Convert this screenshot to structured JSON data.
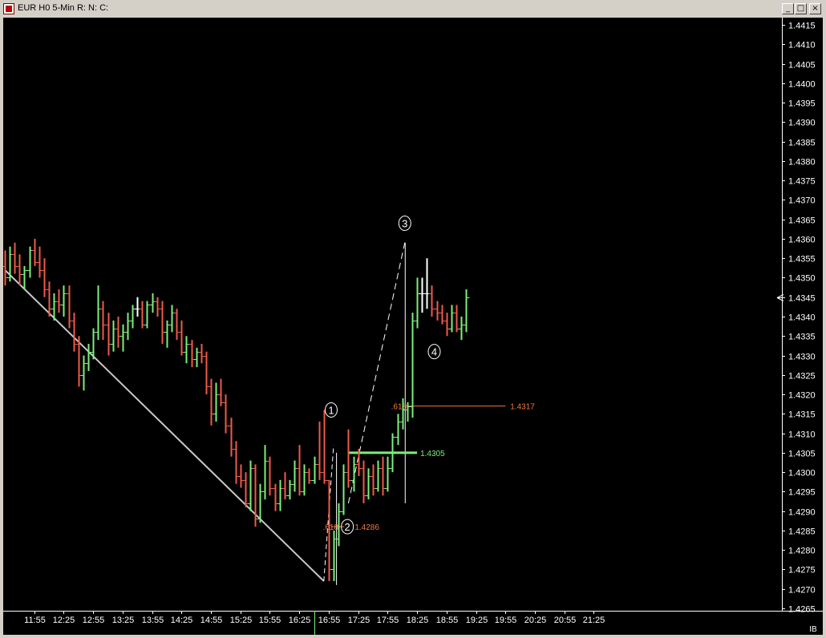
{
  "window": {
    "title": "EUR H0 5-Min R: N: C:",
    "minimize_label": "_",
    "restore_label": "□",
    "close_label": "×"
  },
  "chart_data": {
    "type": "ohlc",
    "instrument": "EUR H0",
    "interval": "5-Min",
    "ylim": [
      1.4263,
      1.4418
    ],
    "y_ticks": [
      "1.4265",
      "1.4270",
      "1.4275",
      "1.4280",
      "1.4285",
      "1.4290",
      "1.4295",
      "1.4300",
      "1.4305",
      "1.4310",
      "1.4315",
      "1.4320",
      "1.4325",
      "1.4330",
      "1.4335",
      "1.4340",
      "1.4345",
      "1.4350",
      "1.4355",
      "1.4360",
      "1.4365",
      "1.4370",
      "1.4375",
      "1.4380",
      "1.4385",
      "1.4390",
      "1.4395",
      "1.4400",
      "1.4405",
      "1.4410",
      "1.4415"
    ],
    "x_ticks": [
      "11:55",
      "12:25",
      "12:55",
      "13:25",
      "13:55",
      "14:25",
      "14:55",
      "15:25",
      "15:55",
      "16:25",
      "16:55",
      "17:25",
      "17:55",
      "18:25",
      "18:55",
      "19:25",
      "19:55",
      "20:25",
      "20:55",
      "21:25"
    ],
    "x_tick_bar_index": [
      6,
      12,
      18,
      24,
      30,
      36,
      42,
      48,
      54,
      60,
      66,
      72,
      78,
      84,
      90,
      96,
      102,
      108,
      114,
      120
    ],
    "bars": [
      [
        1.4353,
        1.4357,
        1.4348,
        1.435
      ],
      [
        1.435,
        1.4358,
        1.4349,
        1.4356
      ],
      [
        1.4356,
        1.4359,
        1.4351,
        1.4353
      ],
      [
        1.4353,
        1.4356,
        1.4348,
        1.4351
      ],
      [
        1.4351,
        1.4353,
        1.4347,
        1.4352
      ],
      [
        1.4352,
        1.4358,
        1.435,
        1.4357
      ],
      [
        1.4357,
        1.436,
        1.4353,
        1.4354
      ],
      [
        1.4354,
        1.4358,
        1.435,
        1.4352
      ],
      [
        1.4352,
        1.4355,
        1.4345,
        1.4347
      ],
      [
        1.4347,
        1.4349,
        1.434,
        1.4342
      ],
      [
        1.4342,
        1.4346,
        1.4339,
        1.4344
      ],
      [
        1.4344,
        1.4347,
        1.4341,
        1.4343
      ],
      [
        1.4343,
        1.4348,
        1.434,
        1.4346
      ],
      [
        1.4346,
        1.4348,
        1.4337,
        1.4339
      ],
      [
        1.4339,
        1.4341,
        1.4331,
        1.4333
      ],
      [
        1.4333,
        1.4335,
        1.4322,
        1.4325
      ],
      [
        1.4325,
        1.433,
        1.4321,
        1.4328
      ],
      [
        1.4328,
        1.4333,
        1.4326,
        1.4331
      ],
      [
        1.4331,
        1.4337,
        1.4329,
        1.4336
      ],
      [
        1.4336,
        1.4348,
        1.4334,
        1.4342
      ],
      [
        1.4342,
        1.4344,
        1.4334,
        1.4338
      ],
      [
        1.4338,
        1.4341,
        1.433,
        1.4333
      ],
      [
        1.4333,
        1.4339,
        1.4331,
        1.4337
      ],
      [
        1.4337,
        1.434,
        1.4332,
        1.4335
      ],
      [
        1.4335,
        1.4338,
        1.4331,
        1.4336
      ],
      [
        1.4336,
        1.4341,
        1.4334,
        1.4339
      ],
      [
        1.4339,
        1.4343,
        1.4337,
        1.4342
      ],
      [
        1.4342,
        1.4345,
        1.434,
        1.4342
      ],
      [
        1.4342,
        1.4344,
        1.4337,
        1.4338
      ],
      [
        1.4338,
        1.4344,
        1.4337,
        1.4343
      ],
      [
        1.4343,
        1.4346,
        1.4341,
        1.4344
      ],
      [
        1.4344,
        1.4345,
        1.434,
        1.4342
      ],
      [
        1.4342,
        1.4344,
        1.4333,
        1.4336
      ],
      [
        1.4336,
        1.4339,
        1.4332,
        1.4338
      ],
      [
        1.4338,
        1.4343,
        1.4336,
        1.4341
      ],
      [
        1.4341,
        1.4342,
        1.4334,
        1.4336
      ],
      [
        1.4336,
        1.4339,
        1.433,
        1.4331
      ],
      [
        1.4331,
        1.4335,
        1.4328,
        1.4333
      ],
      [
        1.4333,
        1.4334,
        1.4327,
        1.4329
      ],
      [
        1.4329,
        1.4332,
        1.4327,
        1.4331
      ],
      [
        1.4331,
        1.4333,
        1.4328,
        1.433
      ],
      [
        1.433,
        1.4331,
        1.432,
        1.4322
      ],
      [
        1.4322,
        1.4324,
        1.4312,
        1.4315
      ],
      [
        1.4315,
        1.4323,
        1.4313,
        1.432
      ],
      [
        1.432,
        1.4324,
        1.4317,
        1.4318
      ],
      [
        1.4318,
        1.432,
        1.431,
        1.4312
      ],
      [
        1.4312,
        1.4314,
        1.4304,
        1.4306
      ],
      [
        1.4306,
        1.4308,
        1.4297,
        1.4299
      ],
      [
        1.4299,
        1.4302,
        1.4296,
        1.4298
      ],
      [
        1.4298,
        1.43,
        1.4291,
        1.4292
      ],
      [
        1.4292,
        1.4303,
        1.429,
        1.4301
      ],
      [
        1.4301,
        1.4302,
        1.4286,
        1.4288
      ],
      [
        1.4288,
        1.4297,
        1.4287,
        1.4295
      ],
      [
        1.4295,
        1.4307,
        1.4293,
        1.4303
      ],
      [
        1.4303,
        1.4304,
        1.4294,
        1.4296
      ],
      [
        1.4296,
        1.4297,
        1.429,
        1.4292
      ],
      [
        1.4292,
        1.4298,
        1.429,
        1.4296
      ],
      [
        1.4296,
        1.43,
        1.4293,
        1.4294
      ],
      [
        1.4294,
        1.4298,
        1.4293,
        1.4297
      ],
      [
        1.4297,
        1.4303,
        1.4295,
        1.4301
      ],
      [
        1.4301,
        1.4307,
        1.4294,
        1.4295
      ],
      [
        1.4295,
        1.4302,
        1.4294,
        1.43
      ],
      [
        1.43,
        1.4301,
        1.4297,
        1.4298
      ],
      [
        1.4298,
        1.4304,
        1.4297,
        1.4302
      ],
      [
        1.4302,
        1.4313,
        1.4298,
        1.43
      ],
      [
        1.43,
        1.4316,
        1.4297,
        1.4298
      ],
      [
        1.4298,
        1.4298,
        1.4272,
        1.4275
      ],
      [
        1.4275,
        1.4285,
        1.4272,
        1.4283
      ],
      [
        1.4283,
        1.4292,
        1.4281,
        1.429
      ],
      [
        1.429,
        1.4302,
        1.4289,
        1.43
      ],
      [
        1.43,
        1.4311,
        1.4296,
        1.4298
      ],
      [
        1.4298,
        1.4304,
        1.4295,
        1.4302
      ],
      [
        1.4302,
        1.4306,
        1.4299,
        1.4301
      ],
      [
        1.4301,
        1.4303,
        1.4292,
        1.4294
      ],
      [
        1.4294,
        1.4301,
        1.4293,
        1.4299
      ],
      [
        1.4299,
        1.4302,
        1.4294,
        1.4296
      ],
      [
        1.4296,
        1.4303,
        1.4295,
        1.4301
      ],
      [
        1.4301,
        1.4304,
        1.4294,
        1.4296
      ],
      [
        1.4296,
        1.4304,
        1.4295,
        1.4301
      ],
      [
        1.4301,
        1.431,
        1.43,
        1.4309
      ],
      [
        1.4309,
        1.4315,
        1.4307,
        1.4313
      ],
      [
        1.4313,
        1.4319,
        1.4311,
        1.4316
      ],
      [
        1.4316,
        1.4318,
        1.4313,
        1.4317
      ],
      [
        1.4317,
        1.4341,
        1.4314,
        1.4339
      ],
      [
        1.4339,
        1.435,
        1.4337,
        1.4346
      ],
      [
        1.4346,
        1.435,
        1.4341,
        1.4346
      ],
      [
        1.4346,
        1.4355,
        1.4342,
        1.4346
      ],
      [
        1.4346,
        1.4348,
        1.434,
        1.4342
      ],
      [
        1.4342,
        1.4344,
        1.4339,
        1.4341
      ],
      [
        1.4341,
        1.4343,
        1.4338,
        1.4339
      ],
      [
        1.4339,
        1.4341,
        1.4335,
        1.4337
      ],
      [
        1.4337,
        1.4343,
        1.4336,
        1.4341
      ],
      [
        1.4341,
        1.4343,
        1.4336,
        1.4337
      ],
      [
        1.4337,
        1.434,
        1.4334,
        1.4338
      ],
      [
        1.4338,
        1.4347,
        1.4336,
        1.4345
      ]
    ],
    "current_price": "1.4345",
    "retracement_levels": [
      {
        "ratio_label": ".618",
        "price_label": "1.4286",
        "price": 1.4286
      },
      {
        "ratio_label": ".618",
        "price_label": "1.4317",
        "price": 1.4317
      }
    ],
    "level_line": {
      "price_label": "1.4305",
      "price": 1.4305
    },
    "wave_labels": [
      {
        "label": "1",
        "bar": 66.5,
        "price": 1.4316
      },
      {
        "label": "2",
        "bar": 69.8,
        "price": 1.4286
      },
      {
        "label": "3",
        "bar": 81.5,
        "price": 1.4364
      },
      {
        "label": "4",
        "bar": 87.5,
        "price": 1.4331
      }
    ],
    "trendline": [
      [
        0,
        1.4352
      ],
      [
        65,
        1.4272
      ]
    ],
    "footer_label": "IB",
    "colors": {
      "background": "#000000",
      "up_bar": "#7bf07b",
      "down_bar": "#f05a4a",
      "neutral_bar": "#ffffff",
      "trendline": "#c8c8c8",
      "retracement": "#f07a40",
      "level_line": "#7bf07b",
      "axis": "#ffffff"
    }
  }
}
